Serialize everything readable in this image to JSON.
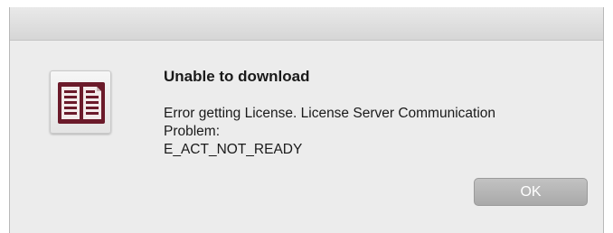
{
  "dialog": {
    "icon": "ebook-reader-app-icon",
    "title": "Unable to download",
    "message_lines": [
      "Error getting License. License Server Communication",
      "Problem:",
      "E_ACT_NOT_READY"
    ],
    "ok_label": "OK"
  },
  "colors": {
    "icon_book": "#6b1a2a",
    "button": "#b5b5b5"
  }
}
